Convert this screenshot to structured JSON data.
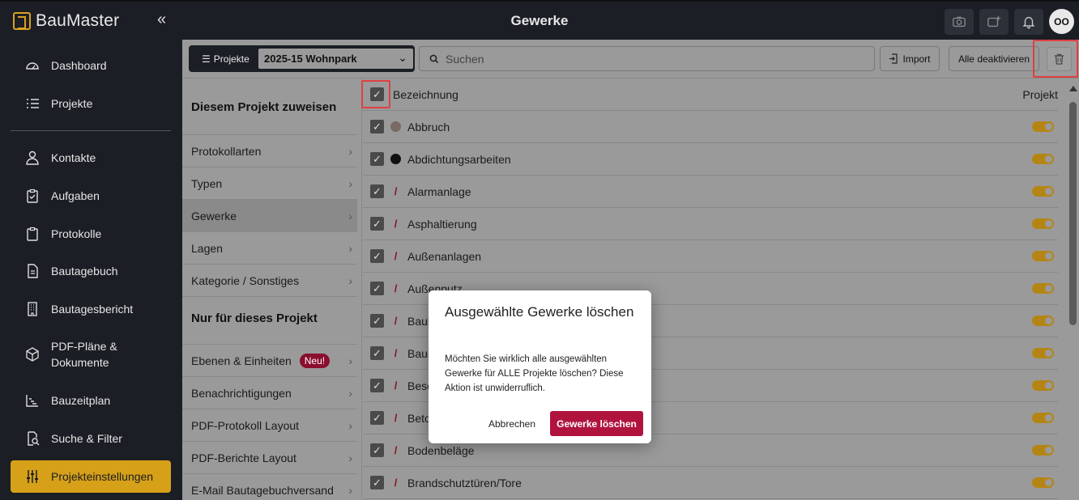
{
  "app": {
    "brand": "BauMaster",
    "title": "Gewerke",
    "user_initials": "OO"
  },
  "sidebar": {
    "items": [
      {
        "label": "Dashboard"
      },
      {
        "label": "Projekte"
      },
      {
        "label": "Kontakte"
      },
      {
        "label": "Aufgaben"
      },
      {
        "label": "Protokolle"
      },
      {
        "label": "Bautagebuch"
      },
      {
        "label": "Bautagesbericht"
      },
      {
        "label": "PDF-Pläne &",
        "label2": "Dokumente"
      },
      {
        "label": "Bauzeitplan"
      },
      {
        "label": "Suche & Filter"
      },
      {
        "label": "Projekteinstellungen"
      }
    ]
  },
  "toolbar": {
    "projects_label": "Projekte",
    "project_value": "2025-15 Wohnpark",
    "search_placeholder": "Suchen",
    "import_label": "Import",
    "deactivate_label": "Alle deaktivieren"
  },
  "settings_nav": {
    "heading1": "Diesem Projekt zuweisen",
    "group1": [
      "Protokollarten",
      "Typen",
      "Gewerke",
      "Lagen",
      "Kategorie / Sonstiges"
    ],
    "heading2": "Nur für dieses Projekt",
    "group2": [
      "Ebenen & Einheiten",
      "Benachrichtigungen",
      "PDF-Protokoll Layout",
      "PDF-Berichte Layout",
      "E-Mail Bautagebuchversand"
    ],
    "new_badge": "Neu!"
  },
  "list": {
    "col_name": "Bezeichnung",
    "col_project": "Projekt",
    "rows": [
      {
        "name": "Abbruch",
        "color": "#7a6a64",
        "marker": "dot"
      },
      {
        "name": "Abdichtungsarbeiten",
        "color": "#111111",
        "marker": "dot"
      },
      {
        "name": "Alarmanlage",
        "color": "#8a1020",
        "marker": "slash"
      },
      {
        "name": "Asphaltierung",
        "color": "#8a1020",
        "marker": "slash"
      },
      {
        "name": "Außenanlagen",
        "color": "#8a1020",
        "marker": "slash"
      },
      {
        "name": "Außenputz",
        "color": "#8a1020",
        "marker": "slash"
      },
      {
        "name": "Bauk",
        "color": "#8a1020",
        "marker": "slash"
      },
      {
        "name": "Baur",
        "color": "#8a1020",
        "marker": "slash"
      },
      {
        "name": "Besc",
        "color": "#8a1020",
        "marker": "slash"
      },
      {
        "name": "Beto",
        "color": "#8a1020",
        "marker": "slash"
      },
      {
        "name": "Bodenbeläge",
        "color": "#8a1020",
        "marker": "slash"
      },
      {
        "name": "Brandschutztüren/Tore",
        "color": "#8a1020",
        "marker": "slash"
      }
    ]
  },
  "modal": {
    "title": "Ausgewählte Gewerke löschen",
    "text": "Möchten Sie wirklich alle ausgewählten Gewerke für ALLE Projekte löschen? Diese Aktion ist unwiderruflich.",
    "cancel": "Abbrechen",
    "confirm": "Gewerke löschen"
  },
  "colors": {
    "accent": "#d6a018",
    "danger": "#b0143e"
  }
}
